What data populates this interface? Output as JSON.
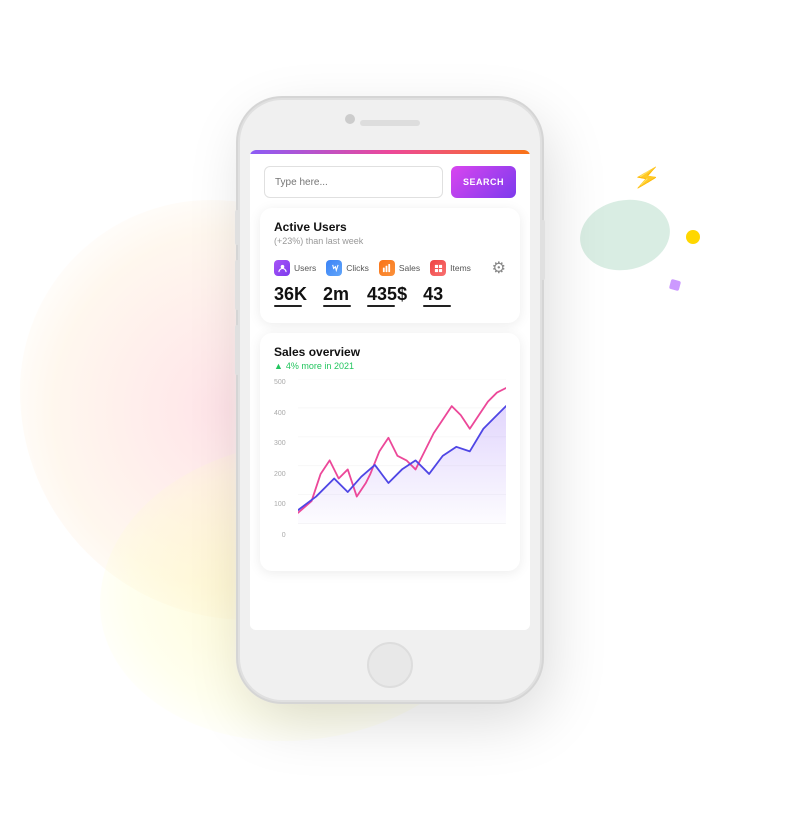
{
  "background": {
    "blob_colors": {
      "pink": "rgba(255,200,210,0.5)",
      "yellow": "rgba(255,245,180,0.6)",
      "green": "rgba(180,220,200,0.5)"
    },
    "accent_colors": {
      "lightning": "#FFD700",
      "dot_yellow": "#FFD700",
      "dot_purple": "#CC99FF"
    }
  },
  "search": {
    "placeholder": "Type here...",
    "button_label": "SEARCH"
  },
  "stats": {
    "title": "Active Users",
    "subtitle": "(+23%) than last week",
    "items": [
      {
        "label": "Users",
        "icon_type": "users",
        "value": "36K"
      },
      {
        "label": "Clicks",
        "icon_type": "clicks",
        "value": "2m"
      },
      {
        "label": "Sales",
        "icon_type": "sales",
        "value": "435$"
      },
      {
        "label": "Items",
        "icon_type": "items",
        "value": "43"
      }
    ]
  },
  "sales_overview": {
    "title": "Sales overview",
    "subtitle": "4% more in 2021",
    "chart": {
      "y_labels": [
        "500",
        "400",
        "300",
        "200",
        "100",
        "0"
      ],
      "line1_color": "#ec4899",
      "line2_color": "#4f46e5",
      "area_color": "rgba(139,92,246,0.15)"
    }
  }
}
